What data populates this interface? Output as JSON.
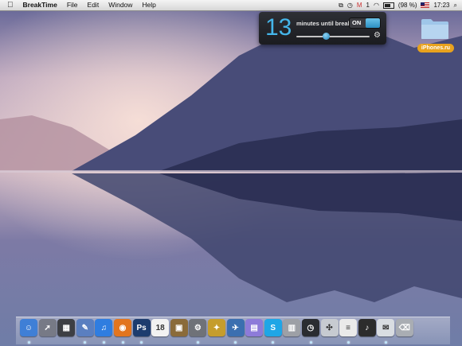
{
  "menubar": {
    "apple_icon": "apple-icon",
    "app_name": "BreakTime",
    "menus": [
      "File",
      "Edit",
      "Window",
      "Help"
    ],
    "status": {
      "mail_count": "1",
      "battery": "(98 %)",
      "time": "17:23"
    }
  },
  "breaktime_popup": {
    "minutes": "13",
    "caption": "minutes until break",
    "toggle_label": "ON",
    "toggle_on": true,
    "slider_level": 0.4
  },
  "desktop": {
    "folder_label": "iPhones.ru"
  },
  "dock": {
    "apps": [
      {
        "name": "finder-icon",
        "color": "#3f7fd6",
        "glyph": "☺"
      },
      {
        "name": "rocket-icon",
        "color": "#777a86",
        "glyph": "➚"
      },
      {
        "name": "activity-monitor-icon",
        "color": "#3d3f44",
        "glyph": "▦"
      },
      {
        "name": "xcode-icon",
        "color": "#5a7fc0",
        "glyph": "✎"
      },
      {
        "name": "itunes-icon",
        "color": "#2f7de0",
        "glyph": "♫"
      },
      {
        "name": "firefox-icon",
        "color": "#e2751e",
        "glyph": "◉"
      },
      {
        "name": "photoshop-icon",
        "color": "#1d3c6e",
        "glyph": "Ps"
      },
      {
        "name": "calendar-icon",
        "color": "#f2f2f2",
        "glyph": "18"
      },
      {
        "name": "iphoto-icon",
        "color": "#8a6b3a",
        "glyph": "▣"
      },
      {
        "name": "tools-icon",
        "color": "#6f7278",
        "glyph": "⚙"
      },
      {
        "name": "network-icon",
        "color": "#c59d2c",
        "glyph": "✦"
      },
      {
        "name": "twitter-icon",
        "color": "#3b6fb0",
        "glyph": "✈"
      },
      {
        "name": "archive-icon",
        "color": "#8d7bd9",
        "glyph": "▤"
      },
      {
        "name": "skype-icon",
        "color": "#1fa6e6",
        "glyph": "S"
      },
      {
        "name": "calculator-icon",
        "color": "#9da0a6",
        "glyph": "▥"
      },
      {
        "name": "clock-icon",
        "color": "#2a2c31",
        "glyph": "◷"
      },
      {
        "name": "system-preferences-icon",
        "color": "#c7cbd1",
        "glyph": "✣"
      },
      {
        "name": "document-icon",
        "color": "#eaeaea",
        "glyph": "≡"
      },
      {
        "name": "music-icon",
        "color": "#2c2c2c",
        "glyph": "♪"
      },
      {
        "name": "mail-icon",
        "color": "#d9dde2",
        "glyph": "✉"
      },
      {
        "name": "trash-icon",
        "color": "#a9adb3",
        "glyph": "⌫"
      }
    ],
    "running_indicators": [
      0,
      3,
      4,
      5,
      6,
      9,
      11,
      13,
      15,
      17,
      19
    ]
  }
}
